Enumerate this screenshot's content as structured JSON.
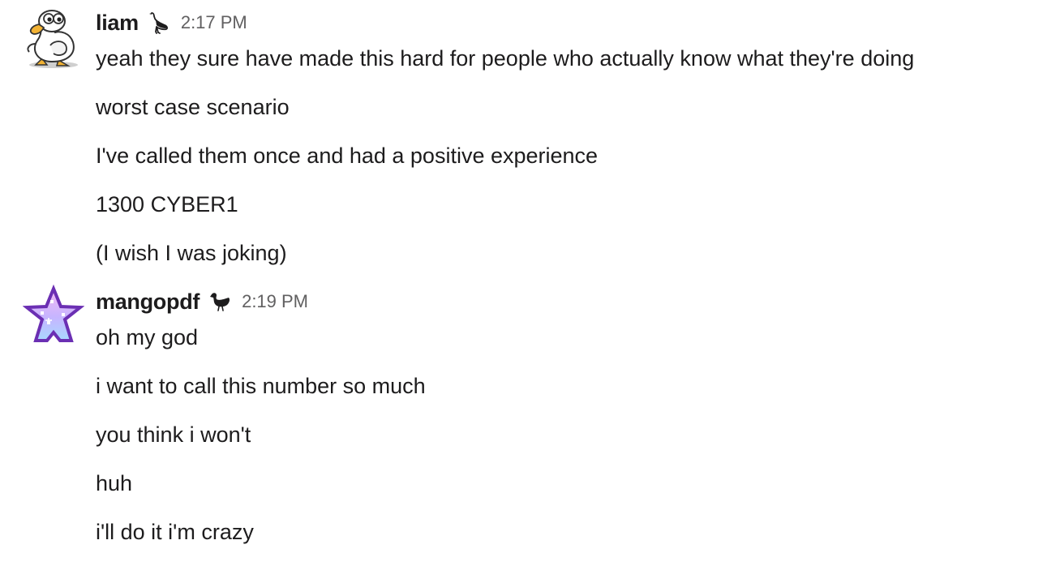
{
  "messages": [
    {
      "author": "liam",
      "avatar_icon": "duck-avatar-icon",
      "status_icon": "wading-bird-icon",
      "time": "2:17 PM",
      "lines": [
        "yeah they sure have made this hard for people who actually know what they're doing",
        "worst case scenario",
        "I've called them once and had a positive experience",
        "1300 CYBER1",
        "(I wish I was joking)"
      ]
    },
    {
      "author": "mangopdf",
      "avatar_icon": "pixel-star-avatar-icon",
      "status_icon": "duck-silhouette-icon",
      "time": "2:19 PM",
      "lines": [
        "oh my god",
        "i want to call this number so much",
        "you think i won't",
        "huh",
        "i'll do it i'm crazy"
      ]
    }
  ],
  "colors": {
    "text": "#1d1c1d",
    "timestamp": "#616061",
    "background": "#ffffff"
  }
}
